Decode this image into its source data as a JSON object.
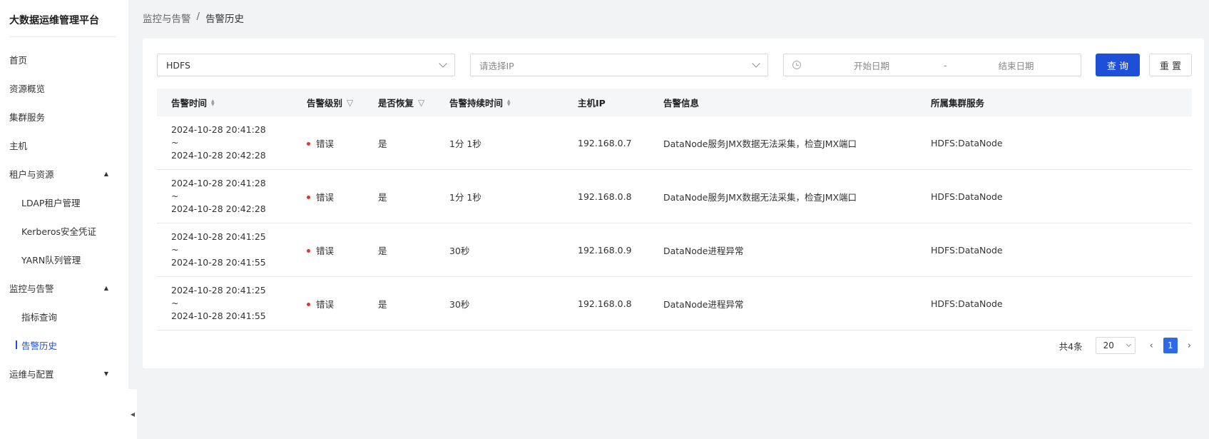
{
  "app": {
    "title": "大数据运维管理平台"
  },
  "sidebar": {
    "items": [
      {
        "label": "首页",
        "sub": false
      },
      {
        "label": "资源概览",
        "sub": false
      },
      {
        "label": "集群服务",
        "sub": false
      },
      {
        "label": "主机",
        "sub": false
      },
      {
        "label": "租户与资源",
        "sub": false,
        "caret": "▲"
      },
      {
        "label": "LDAP租户管理",
        "sub": true
      },
      {
        "label": "Kerberos安全凭证",
        "sub": true
      },
      {
        "label": "YARN队列管理",
        "sub": true
      },
      {
        "label": "监控与告警",
        "sub": false,
        "caret": "▲"
      },
      {
        "label": "指标查询",
        "sub": true
      },
      {
        "label": "告警历史",
        "sub": true,
        "active": true
      },
      {
        "label": "运维与配置",
        "sub": false,
        "caret": "▼"
      }
    ],
    "collapse_glyph": "◀"
  },
  "breadcrumb": {
    "parent": "监控与告警",
    "separator": "/",
    "current": "告警历史"
  },
  "filters": {
    "service_value": "HDFS",
    "ip_placeholder": "请选择IP",
    "date_start_placeholder": "开始日期",
    "date_sep": "-",
    "date_end_placeholder": "结束日期",
    "query_label": "查 询",
    "reset_label": "重 置"
  },
  "table": {
    "headers": {
      "time": "告警时间",
      "level": "告警级别",
      "recovered": "是否恢复",
      "duration": "告警持续时间",
      "host_ip": "主机IP",
      "info": "告警信息",
      "service": "所属集群服务"
    },
    "rows": [
      {
        "start": "2024-10-28 20:41:28",
        "tilde": "~",
        "end": "2024-10-28 20:42:28",
        "level": "错误",
        "recovered": "是",
        "duration": "1分 1秒",
        "ip": "192.168.0.7",
        "info": "DataNode服务JMX数据无法采集，检查JMX端口",
        "service": "HDFS:DataNode"
      },
      {
        "start": "2024-10-28 20:41:28",
        "tilde": "~",
        "end": "2024-10-28 20:42:28",
        "level": "错误",
        "recovered": "是",
        "duration": "1分 1秒",
        "ip": "192.168.0.8",
        "info": "DataNode服务JMX数据无法采集，检查JMX端口",
        "service": "HDFS:DataNode"
      },
      {
        "start": "2024-10-28 20:41:25",
        "tilde": "~",
        "end": "2024-10-28 20:41:55",
        "level": "错误",
        "recovered": "是",
        "duration": "30秒",
        "ip": "192.168.0.9",
        "info": "DataNode进程异常",
        "service": "HDFS:DataNode"
      },
      {
        "start": "2024-10-28 20:41:25",
        "tilde": "~",
        "end": "2024-10-28 20:41:55",
        "level": "错误",
        "recovered": "是",
        "duration": "30秒",
        "ip": "192.168.0.8",
        "info": "DataNode进程异常",
        "service": "HDFS:DataNode"
      }
    ]
  },
  "pagination": {
    "total_text": "共4条",
    "page_size": "20",
    "current_page": "1",
    "prev": "‹",
    "next": "›"
  },
  "colors": {
    "primary": "#1d4fd8",
    "error_dot": "#e03535",
    "page_active": "#2f6ae6"
  }
}
